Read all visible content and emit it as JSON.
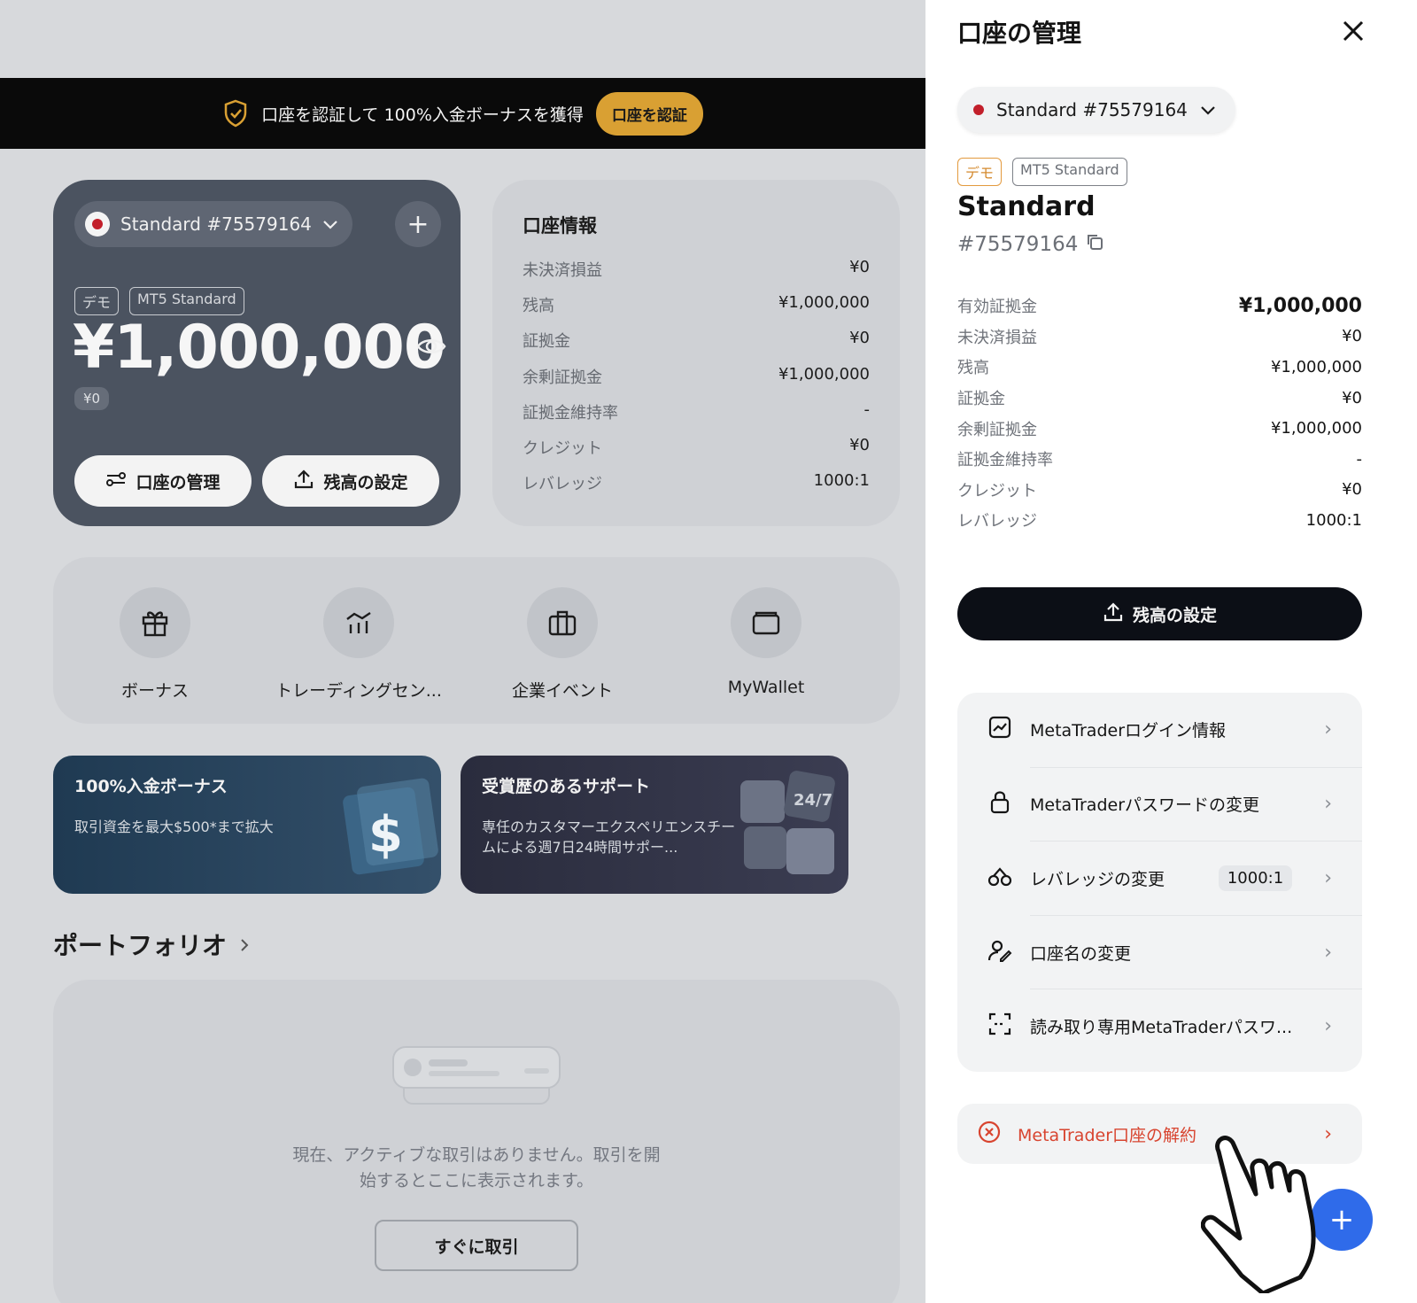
{
  "promo_banner": {
    "text": "口座を認証して 100%入金ボーナスを獲得",
    "button": "口座を認証"
  },
  "balance_card": {
    "account_selector": "Standard #75579164",
    "tags": [
      "デモ",
      "MT5 Standard"
    ],
    "amount": "¥1,000,000",
    "pnl_badge": "¥0",
    "manage_button": "口座の管理",
    "set_balance_button": "残高の設定"
  },
  "account_info": {
    "title": "口座情報",
    "rows": [
      {
        "label": "未決済損益",
        "value": "¥0"
      },
      {
        "label": "残高",
        "value": "¥1,000,000"
      },
      {
        "label": "証拠金",
        "value": "¥0"
      },
      {
        "label": "余剰証拠金",
        "value": "¥1,000,000"
      },
      {
        "label": "証拠金維持率",
        "value": "-"
      },
      {
        "label": "クレジット",
        "value": "¥0"
      },
      {
        "label": "レバレッジ",
        "value": "1000:1"
      }
    ]
  },
  "quick_actions": [
    {
      "label": "ボーナス",
      "icon": "gift-icon"
    },
    {
      "label": "トレーディングセン...",
      "icon": "chart-icon"
    },
    {
      "label": "企業イベント",
      "icon": "briefcase-icon"
    },
    {
      "label": "MyWallet",
      "icon": "wallet-icon"
    }
  ],
  "promo_cards": [
    {
      "title": "100%入金ボーナス",
      "desc": "取引資金を最大$500*まで拡大"
    },
    {
      "title": "受賞歴のあるサポート",
      "desc": "専任のカスタマーエクスペリエンスチームによる週7日24時間サポー..."
    }
  ],
  "portfolio": {
    "title": "ポートフォリオ",
    "empty_text_1": "現在、アクティブな取引はありません。取引を開",
    "empty_text_2": "始するとここに表示されます。",
    "trade_button": "すぐに取引"
  },
  "drawer": {
    "title": "口座の管理",
    "account_selector": "Standard #75579164",
    "tag_demo": "デモ",
    "tag_mt5": "MT5 Standard",
    "account_name": "Standard",
    "account_number": "#75579164",
    "rows": [
      {
        "label": "有効証拠金",
        "value": "¥1,000,000"
      },
      {
        "label": "未決済損益",
        "value": "¥0"
      },
      {
        "label": "残高",
        "value": "¥1,000,000"
      },
      {
        "label": "証拠金",
        "value": "¥0"
      },
      {
        "label": "余剰証拠金",
        "value": "¥1,000,000"
      },
      {
        "label": "証拠金維持率",
        "value": "-"
      },
      {
        "label": "クレジット",
        "value": "¥0"
      },
      {
        "label": "レバレッジ",
        "value": "1000:1"
      }
    ],
    "set_balance_button": "残高の設定",
    "menu": [
      {
        "label": "MetaTraderログイン情報",
        "icon": "chart-login-icon"
      },
      {
        "label": "MetaTraderパスワードの変更",
        "icon": "lock-icon"
      },
      {
        "label": "レバレッジの変更",
        "icon": "scale-icon",
        "badge": "1000:1"
      },
      {
        "label": "口座名の変更",
        "icon": "user-edit-icon"
      },
      {
        "label": "読み取り専用MetaTraderパスワ...",
        "icon": "scan-icon"
      }
    ],
    "cancel_label": "MetaTrader口座の解約"
  },
  "fab_label": "+"
}
